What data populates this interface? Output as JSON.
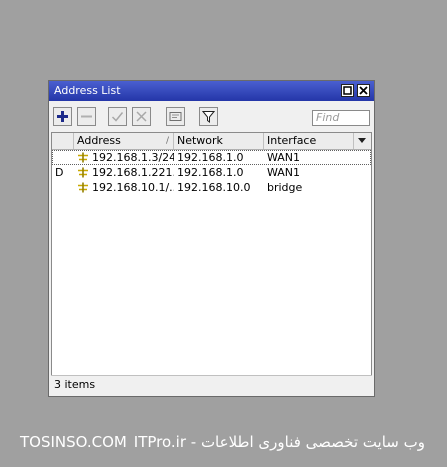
{
  "window": {
    "title": "Address List",
    "icons": {
      "restore": "restore-icon",
      "close": "close-icon"
    }
  },
  "toolbar": {
    "add": "plus-icon",
    "remove": "minus-icon",
    "enable": "check-icon",
    "disable": "x-icon",
    "comment": "comment-icon",
    "filter": "filter-icon",
    "find_placeholder": "Find"
  },
  "table": {
    "columns": [
      "Address",
      "Network",
      "Interface"
    ],
    "rows": [
      {
        "flag": "",
        "address": "192.168.1.3/24",
        "network": "192.168.1.0",
        "interface": "WAN1"
      },
      {
        "flag": "D",
        "address": "192.168.1.221...",
        "network": "192.168.1.0",
        "interface": "WAN1"
      },
      {
        "flag": "",
        "address": "192.168.10.1/...",
        "network": "192.168.10.0",
        "interface": "bridge"
      }
    ]
  },
  "status": {
    "count": "3 items"
  },
  "watermark": {
    "left": "TOSINSO.COM",
    "right": "ITPro.ir - وب سایت تخصصی فناوری اطلاعات"
  },
  "colors": {
    "titlebar": "#2e42b8",
    "plus": "#1d2a8a",
    "row_icon": "#c8a800"
  }
}
